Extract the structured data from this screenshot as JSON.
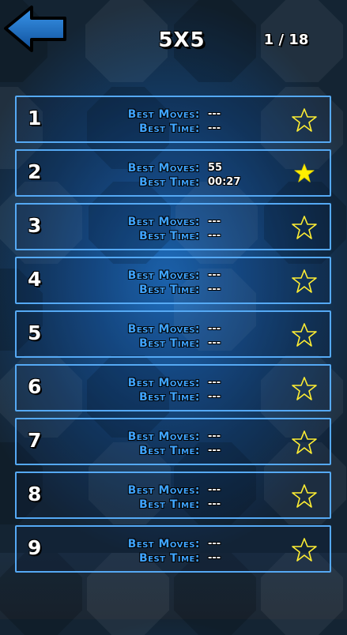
{
  "header": {
    "title": "5X5",
    "page": "1 / 18",
    "back_icon": "back-arrow-icon"
  },
  "labels": {
    "best_moves": "Best Moves:",
    "best_time": "Best Time:"
  },
  "colors": {
    "row_border": "#55a9f4",
    "label": "#3fa4ff",
    "star_filled": "#ffee00",
    "star_outline": "#ffee33",
    "back_arrow": "#1f75c9"
  },
  "levels": [
    {
      "number": "1",
      "best_moves": "---",
      "best_time": "---",
      "star": "star-outline-icon"
    },
    {
      "number": "2",
      "best_moves": "55",
      "best_time": "00:27",
      "star": "star-filled-icon"
    },
    {
      "number": "3",
      "best_moves": "---",
      "best_time": "---",
      "star": "star-outline-icon"
    },
    {
      "number": "4",
      "best_moves": "---",
      "best_time": "---",
      "star": "star-outline-icon"
    },
    {
      "number": "5",
      "best_moves": "---",
      "best_time": "---",
      "star": "star-outline-icon"
    },
    {
      "number": "6",
      "best_moves": "---",
      "best_time": "---",
      "star": "star-outline-icon"
    },
    {
      "number": "7",
      "best_moves": "---",
      "best_time": "---",
      "star": "star-outline-icon"
    },
    {
      "number": "8",
      "best_moves": "---",
      "best_time": "---",
      "star": "star-outline-icon"
    },
    {
      "number": "9",
      "best_moves": "---",
      "best_time": "---",
      "star": "star-outline-icon"
    }
  ]
}
